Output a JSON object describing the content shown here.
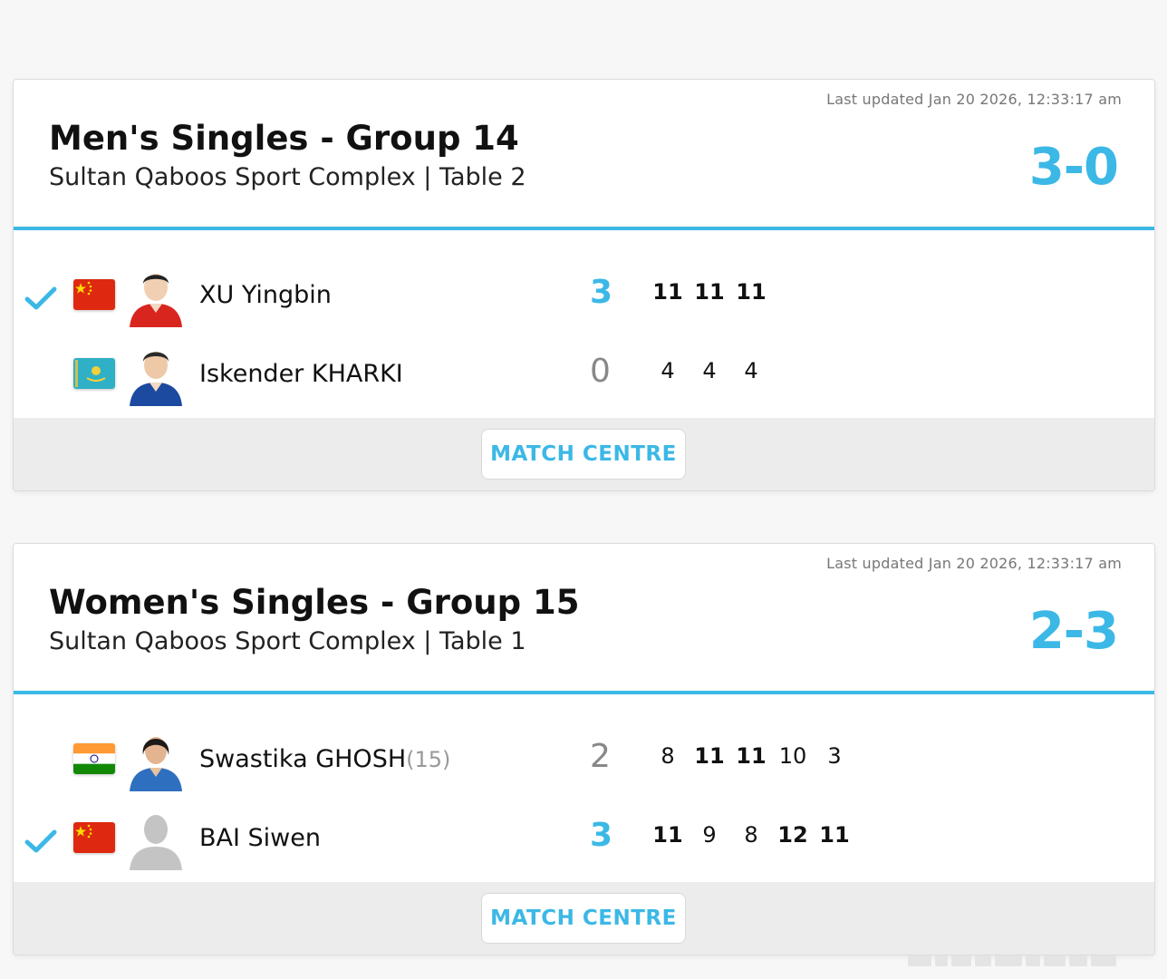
{
  "matches": [
    {
      "last_updated": "Last updated Jan 20 2026, 12:33:17 am",
      "title": "Men's Singles - Group 14",
      "venue": "Sultan Qaboos Sport Complex | Table 2",
      "score": "3-0",
      "players": [
        {
          "name": "XU Yingbin",
          "seed": "",
          "country": "China",
          "sets": "3",
          "winner": true,
          "games": [
            "11",
            "11",
            "11"
          ],
          "won_games": [
            true,
            true,
            true
          ]
        },
        {
          "name": "Iskender KHARKI",
          "seed": "",
          "country": "Kazakhstan",
          "sets": "0",
          "winner": false,
          "games": [
            "4",
            "4",
            "4"
          ],
          "won_games": [
            false,
            false,
            false
          ]
        }
      ],
      "button_label": "MATCH CENTRE"
    },
    {
      "last_updated": "Last updated Jan 20 2026, 12:33:17 am",
      "title": "Women's Singles - Group 15",
      "venue": "Sultan Qaboos Sport Complex | Table 1",
      "score": "2-3",
      "players": [
        {
          "name": "Swastika GHOSH",
          "seed": "(15)",
          "country": "India",
          "sets": "2",
          "winner": false,
          "games": [
            "8",
            "11",
            "11",
            "10",
            "3"
          ],
          "won_games": [
            false,
            true,
            true,
            false,
            false
          ]
        },
        {
          "name": "BAI Siwen",
          "seed": "",
          "country": "China",
          "sets": "3",
          "winner": true,
          "games": [
            "11",
            "9",
            "8",
            "12",
            "11"
          ],
          "won_games": [
            true,
            false,
            false,
            true,
            true
          ]
        }
      ],
      "button_label": "MATCH CENTRE"
    }
  ],
  "colors": {
    "accent": "#3cb8e6",
    "footer": "#ececec"
  },
  "icons": {
    "winner": "check-icon",
    "placeholder_avatar": "person-silhouette-icon"
  }
}
